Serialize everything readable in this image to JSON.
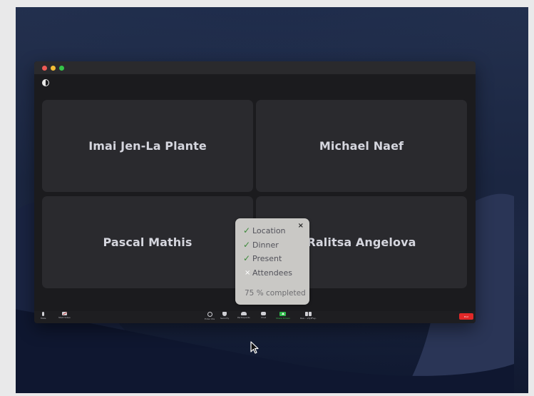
{
  "participants": [
    {
      "name": "Imai Jen-La Plante"
    },
    {
      "name": "Michael Naef"
    },
    {
      "name": "Pascal Mathis"
    },
    {
      "name": "Ralitsa Angelova"
    }
  ],
  "toolbar": {
    "mute_label": "Mute",
    "video_label": "Start Video",
    "audio_label": "Enter Ute",
    "security_label": "Security",
    "participants_label": "Participants",
    "chat_label": "Chat",
    "share_label": "Share Screen",
    "reactions_label": "Rea… eTyPFey..",
    "end_label": "End"
  },
  "checklist": {
    "items": [
      {
        "label": "Location",
        "status": "done",
        "mark": "✓"
      },
      {
        "label": "Dinner",
        "status": "done",
        "mark": "✓"
      },
      {
        "label": "Present",
        "status": "done",
        "mark": "✓"
      },
      {
        "label": "Attendees",
        "status": "not-done",
        "mark": "×"
      }
    ],
    "progress_text": "75 % completed",
    "progress_percent": 75,
    "close_glyph": "×"
  },
  "colors": {
    "window_bg": "#1b1b1e",
    "tile_bg": "#2a2a2e",
    "popup_bg": "#c9c8c5",
    "check_green": "#3d8a3a",
    "share_green": "#2fb84a",
    "end_red": "#e02828"
  }
}
